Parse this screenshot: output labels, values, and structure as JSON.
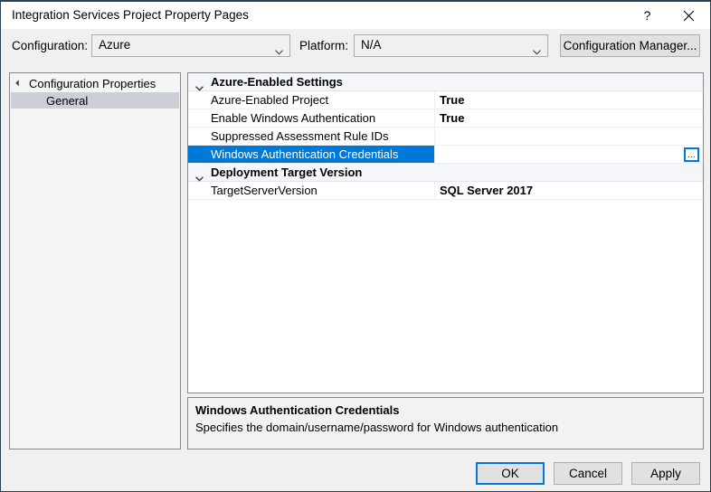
{
  "window": {
    "title": "Integration Services Project Property Pages",
    "help_label": "?",
    "close_icon": "close-icon"
  },
  "config_bar": {
    "configuration_label": "Configuration:",
    "configuration_value": "Azure",
    "platform_label": "Platform:",
    "platform_value": "N/A",
    "configuration_manager_label": "Configuration Manager..."
  },
  "tree": {
    "root_label": "Configuration Properties",
    "child_label": "General"
  },
  "grid": {
    "rows": [
      {
        "kind": "category",
        "name": "Azure-Enabled Settings",
        "value": "",
        "selected": false
      },
      {
        "kind": "property",
        "name": "Azure-Enabled Project",
        "value": "True",
        "selected": false
      },
      {
        "kind": "property",
        "name": "Enable Windows Authentication",
        "value": "True",
        "selected": false
      },
      {
        "kind": "property",
        "name": "Suppressed Assessment Rule IDs",
        "value": "",
        "selected": false
      },
      {
        "kind": "property",
        "name": "Windows Authentication Credentials",
        "value": "",
        "selected": true,
        "ellipsis": "..."
      },
      {
        "kind": "category",
        "name": "Deployment Target Version",
        "value": "",
        "selected": false
      },
      {
        "kind": "property",
        "name": "TargetServerVersion",
        "value": "SQL Server 2017",
        "selected": false
      }
    ]
  },
  "description": {
    "title": "Windows Authentication Credentials",
    "text": "Specifies the domain/username/password for Windows authentication"
  },
  "footer": {
    "ok_label": "OK",
    "cancel_label": "Cancel",
    "apply_label": "Apply"
  },
  "colors": {
    "selection_blue": "#0078d7",
    "dialog_bg": "#f0f0f0",
    "titlebar_bg": "#ffffff",
    "border": "#828790"
  }
}
